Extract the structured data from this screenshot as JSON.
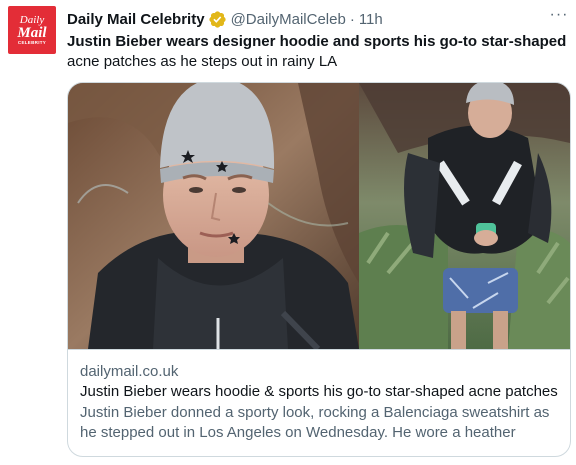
{
  "tweet": {
    "avatar": {
      "line1": "Daily",
      "line2": "Mail",
      "line3": "CELEBRITY",
      "bg_color": "#e32d37"
    },
    "author": {
      "name": "Daily Mail Celebrity",
      "verified_icon": "gold-verified-badge-icon",
      "handle": "@DailyMailCeleb",
      "separator": "·",
      "time": "11h"
    },
    "more_icon": "more-horizontal-icon",
    "more_label": "···",
    "text": {
      "bold": "Justin Bieber wears designer hoodie and sports his go-to star-shaped",
      "rest": "acne patches as he steps out in rainy LA"
    },
    "card": {
      "image_icon": "article-photo-image",
      "domain": "dailymail.co.uk",
      "title": "Justin Bieber wears hoodie & sports his go-to star-shaped acne patches",
      "description": "Justin Bieber donned a sporty look, rocking a Balenciaga sweatshirt as he stepped out in Los Angeles on Wednesday. He wore a heather gray..."
    },
    "colors": {
      "text_primary": "#0f1419",
      "text_secondary": "#536471",
      "border": "#cfd9de",
      "verified_gold": "#e2b719"
    }
  }
}
